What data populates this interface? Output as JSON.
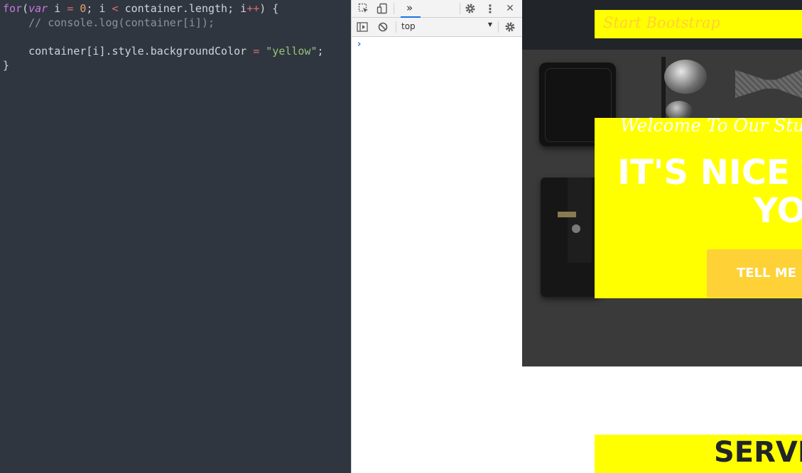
{
  "editor": {
    "lines": [
      [
        "for",
        "(",
        "var",
        " i ",
        "=",
        " ",
        "0",
        "; i ",
        "<",
        " container.length; i",
        "++",
        ") {"
      ],
      [
        "    ",
        "// console.log(container[i]);"
      ],
      [],
      [
        "    container[i].style.backgroundColor ",
        "=",
        " ",
        "\"yellow\"",
        ";"
      ],
      [
        "}"
      ]
    ]
  },
  "devtools": {
    "inspect_icon": "cursor-select-icon",
    "device_icon": "device-toolbar-icon",
    "more_tabs_glyph": "»",
    "settings_icon": "gear-icon",
    "menu_glyph": "⋮",
    "close_glyph": "✕",
    "sidebar_icon": "show-sidebar-icon",
    "clear_icon": "block-icon",
    "context": "top",
    "context_arrow": "▼",
    "prompt_glyph": "›",
    "accent": "#1a73e8"
  },
  "page": {
    "brand": "Start Bootstrap",
    "lead_in": "Welcome To Our Studio!",
    "heading": "IT'S NICE TO MEET YOU",
    "cta": "TELL ME MORE",
    "services": "SERVICES",
    "highlight_color": "#ffff00",
    "accent_color": "#fed136"
  }
}
